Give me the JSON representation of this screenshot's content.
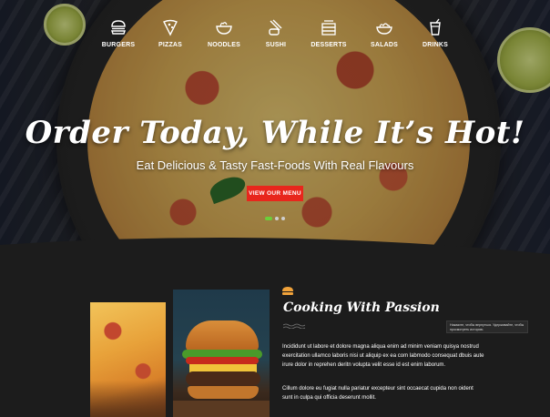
{
  "nav": {
    "items": [
      {
        "label": "BURGERS",
        "icon": "burger-icon"
      },
      {
        "label": "PIZZAS",
        "icon": "pizza-slice-icon"
      },
      {
        "label": "NOODLES",
        "icon": "noodle-bowl-icon"
      },
      {
        "label": "SUSHI",
        "icon": "sushi-chopsticks-icon"
      },
      {
        "label": "DESSERTS",
        "icon": "cake-icon"
      },
      {
        "label": "SALADS",
        "icon": "salad-bowl-icon"
      },
      {
        "label": "DRINKS",
        "icon": "drink-cup-icon"
      }
    ]
  },
  "hero": {
    "title": "Order Today, While It’s Hot!",
    "subtitle": "Eat Delicious & Tasty Fast-Foods With Real Flavours",
    "cta_label": "VIEW OUR MENU",
    "slider": {
      "count": 3,
      "active_index": 0
    }
  },
  "about": {
    "title": "Cooking With Passion",
    "paragraph1": "Incididunt ut labore et dolore magna aliqua enim ad minim veniam quisya nostrud exercitation ullamco laboris nisi ut aliquip ex ea com labmodo consequat dbuis aute irure dolor in reprehen deritn volupta velit esse id est enim laborum.",
    "paragraph2": "Cillum dolore eu fugiat nulla pariatur excepteur sint occaecat cupida non oident sunt in culpa qui officia deserunt mollit.",
    "tooltip": "Нажмите, чтобы вернуться. Удерживайте, чтобы просмотреть историю."
  },
  "colors": {
    "accent_red": "#e8261c",
    "slider_active": "#6bcf3a",
    "section_bg": "#1c1c1c"
  }
}
